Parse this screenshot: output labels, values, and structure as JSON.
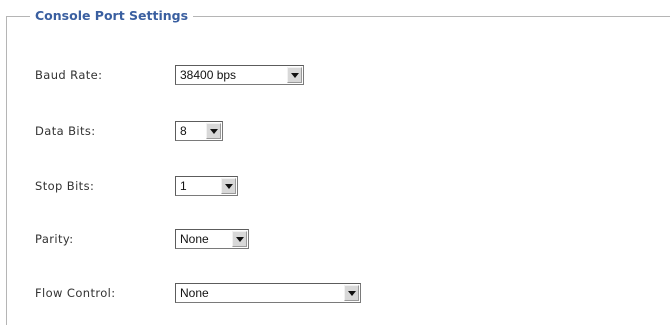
{
  "fieldset": {
    "legend": "Console Port Settings"
  },
  "fields": {
    "baud_rate": {
      "label": "Baud Rate:",
      "value": "38400 bps"
    },
    "data_bits": {
      "label": "Data Bits:",
      "value": "8"
    },
    "stop_bits": {
      "label": "Stop Bits:",
      "value": "1"
    },
    "parity": {
      "label": "Parity:",
      "value": "None"
    },
    "flow_control": {
      "label": "Flow Control:",
      "value": "None"
    }
  },
  "icons": {
    "dropdown_arrow": "chevron-down-icon"
  },
  "colors": {
    "legend_text": "#3a5fa0",
    "label_text": "#333333",
    "frame_border": "#b5b5b5",
    "select_button_bg": "#d8d8d8"
  }
}
